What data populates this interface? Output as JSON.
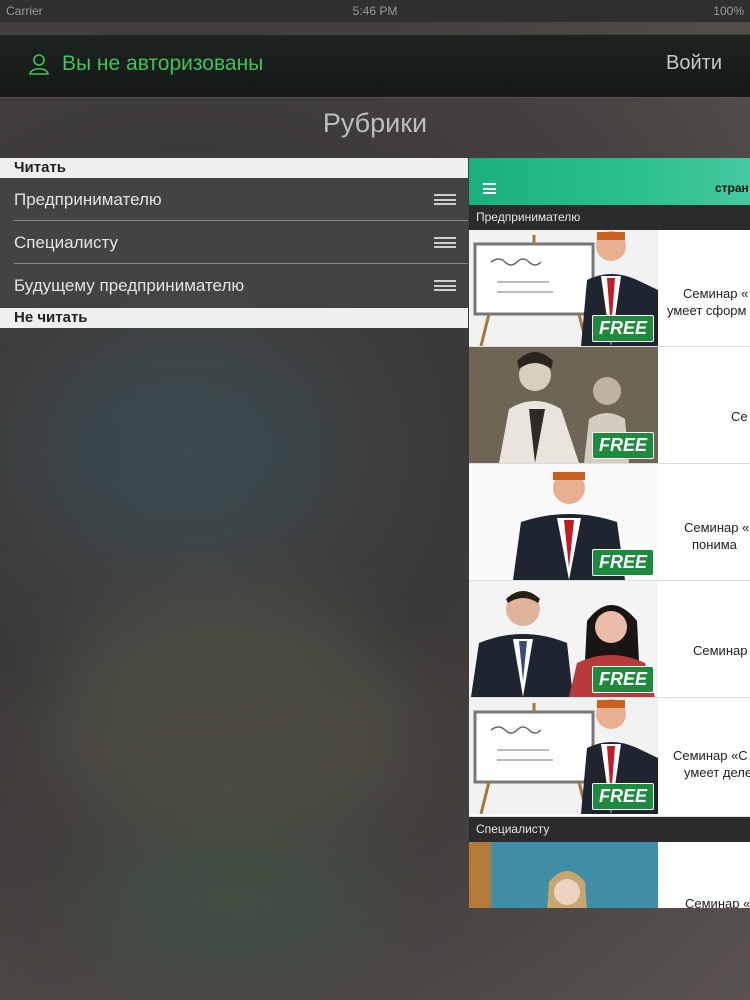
{
  "status_bar": {
    "carrier": "Carrier",
    "time": "5:46 PM",
    "battery": "100%"
  },
  "auth": {
    "status": "Вы не авторизованы",
    "login": "Войти"
  },
  "page_title": "Рубрики",
  "sections": {
    "read": {
      "title": "Читать",
      "items": [
        "Предпринимателю",
        "Специалисту",
        "Будущему предпринимателю"
      ]
    },
    "not_read": {
      "title": "Не читать"
    }
  },
  "right_panel": {
    "header_title": "стран",
    "categories": [
      "Предпринимателю",
      "Специалисту"
    ],
    "badge": "FREE",
    "cards": [
      {
        "line1": "Семинар «",
        "line2": "умеет сформ"
      },
      {
        "line1": "Се",
        "line2": ""
      },
      {
        "line1": "Семинар «",
        "line2": "понима"
      },
      {
        "line1": "Семинар",
        "line2": ""
      },
      {
        "line1": "Семинар «С",
        "line2": "умеет деле"
      },
      {
        "line1": "Семинар «",
        "line2": ""
      }
    ]
  },
  "colors": {
    "accent_green": "#3fc35a",
    "header_teal": "#1bb07f",
    "badge_green": "#1d8a3e"
  },
  "icons": {
    "user": "user-icon",
    "drag": "drag-handle-icon",
    "menu": "hamburger-menu-icon"
  }
}
